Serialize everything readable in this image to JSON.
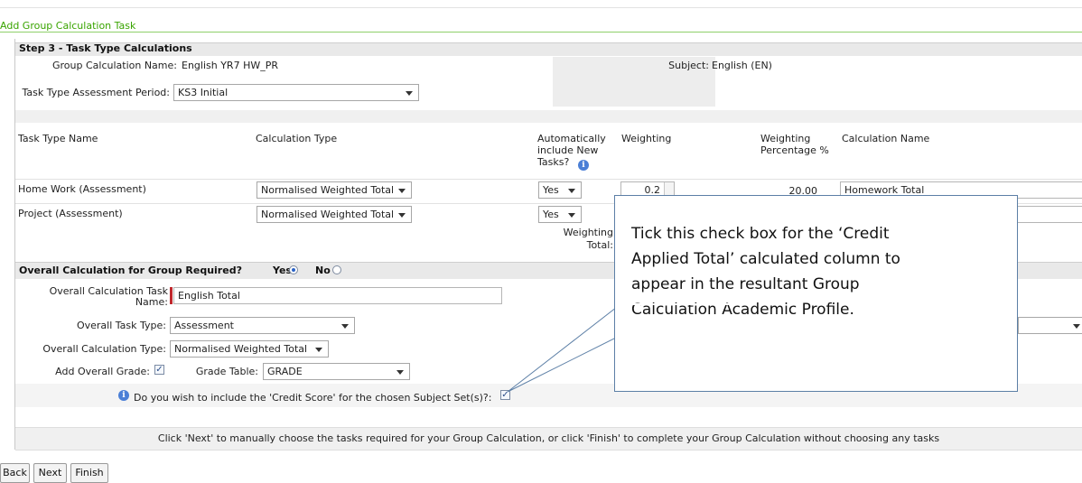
{
  "panel_title": "Add Group Calculation Task",
  "step_title": "Step 3 - Task Type Calculations",
  "group_calc": {
    "label": "Group Calculation Name:",
    "value": "English YR7 HW_PR"
  },
  "subject": {
    "label": "Subject:",
    "value": "English (EN)"
  },
  "assessment_period": {
    "label": "Task Type Assessment Period:",
    "value": "KS3 Initial"
  },
  "table": {
    "headers": {
      "task_type_name": "Task Type Name",
      "calculation_type": "Calculation Type",
      "auto_include": [
        "Automatically",
        "include New",
        "Tasks?"
      ],
      "weighting": "Weighting",
      "weighting_pct": [
        "Weighting",
        "Percentage %"
      ],
      "calculation_name": "Calculation Name"
    },
    "rows": [
      {
        "name": "Home Work (Assessment)",
        "calc_type": "Normalised Weighted Total",
        "auto": "Yes",
        "weighting": "0.2",
        "pct": "20.00",
        "calc_name": "Homework Total"
      },
      {
        "name": "Project (Assessment)",
        "calc_type": "Normalised Weighted Total",
        "auto": "Yes",
        "weighting": "",
        "pct": "",
        "calc_name": ""
      }
    ],
    "weighting_total_label": [
      "Weighting",
      "Total:"
    ]
  },
  "overall": {
    "header": "Overall Calculation for Group Required?",
    "yes_label": "Yes",
    "no_label": "No",
    "selected": "Yes",
    "task_name_label": [
      "Overall Calculation Task",
      "Name:"
    ],
    "task_name_value": "English Total",
    "task_type_label": "Overall Task Type:",
    "task_type_value": "Assessment",
    "calc_type_label": "Overall Calculation Type:",
    "calc_type_value": "Normalised Weighted Total",
    "add_grade_label": "Add Overall Grade:",
    "add_grade_checked": true,
    "grade_table_label": "Grade Table:",
    "grade_table_value": "GRADE",
    "credit_question": "Do you wish to include the 'Credit Score' for the chosen Subject Set(s)?:",
    "credit_checked": true
  },
  "footer_note": "Click 'Next' to manually choose the tasks required for your Group Calculation, or click 'Finish' to complete your Group Calculation without choosing any tasks",
  "buttons": {
    "back": "Back",
    "next": "Next",
    "finish": "Finish"
  },
  "callout": {
    "lines": [
      "Tick this check box for the ‘Credit",
      "Applied Total’ calculated column to",
      "appear in the resultant Group",
      "Calculation Academic Profile."
    ]
  },
  "colors": {
    "title_green": "#39a400",
    "required_red": "#c0282d",
    "info_blue": "#4b7fd6",
    "callout_border": "#5c7fa6"
  }
}
